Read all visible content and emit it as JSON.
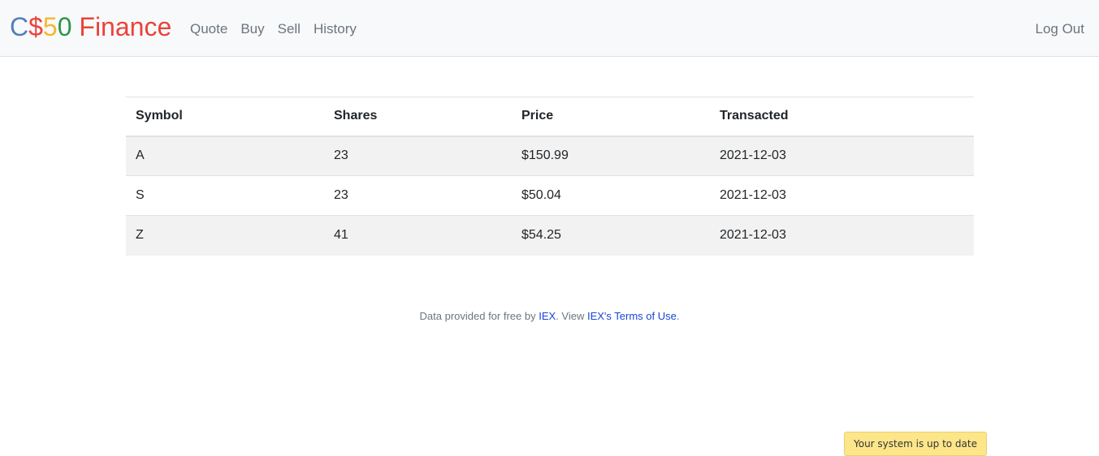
{
  "brand": {
    "parts": [
      {
        "text": "C",
        "color": "#537fbe"
      },
      {
        "text": "$",
        "color": "#ea433b"
      },
      {
        "text": "5",
        "color": "#f5b82e"
      },
      {
        "text": "0",
        "color": "#2e944b"
      },
      {
        "text": " Finance",
        "color": "#ea433b"
      }
    ]
  },
  "nav": {
    "links": [
      "Quote",
      "Buy",
      "Sell",
      "History"
    ],
    "logout": "Log Out"
  },
  "table": {
    "headers": [
      "Symbol",
      "Shares",
      "Price",
      "Transacted"
    ],
    "rows": [
      [
        "A",
        "23",
        "$150.99",
        "2021-12-03"
      ],
      [
        "S",
        "23",
        "$50.04",
        "2021-12-03"
      ],
      [
        "Z",
        "41",
        "$54.25",
        "2021-12-03"
      ]
    ]
  },
  "footer": {
    "prefix": "Data provided for free by ",
    "link1": "IEX",
    "middle": ". View ",
    "link2": "IEX's Terms of Use",
    "suffix": "."
  },
  "notification": {
    "text": "Your system is up to date",
    "bg_color": "#fde68a"
  }
}
